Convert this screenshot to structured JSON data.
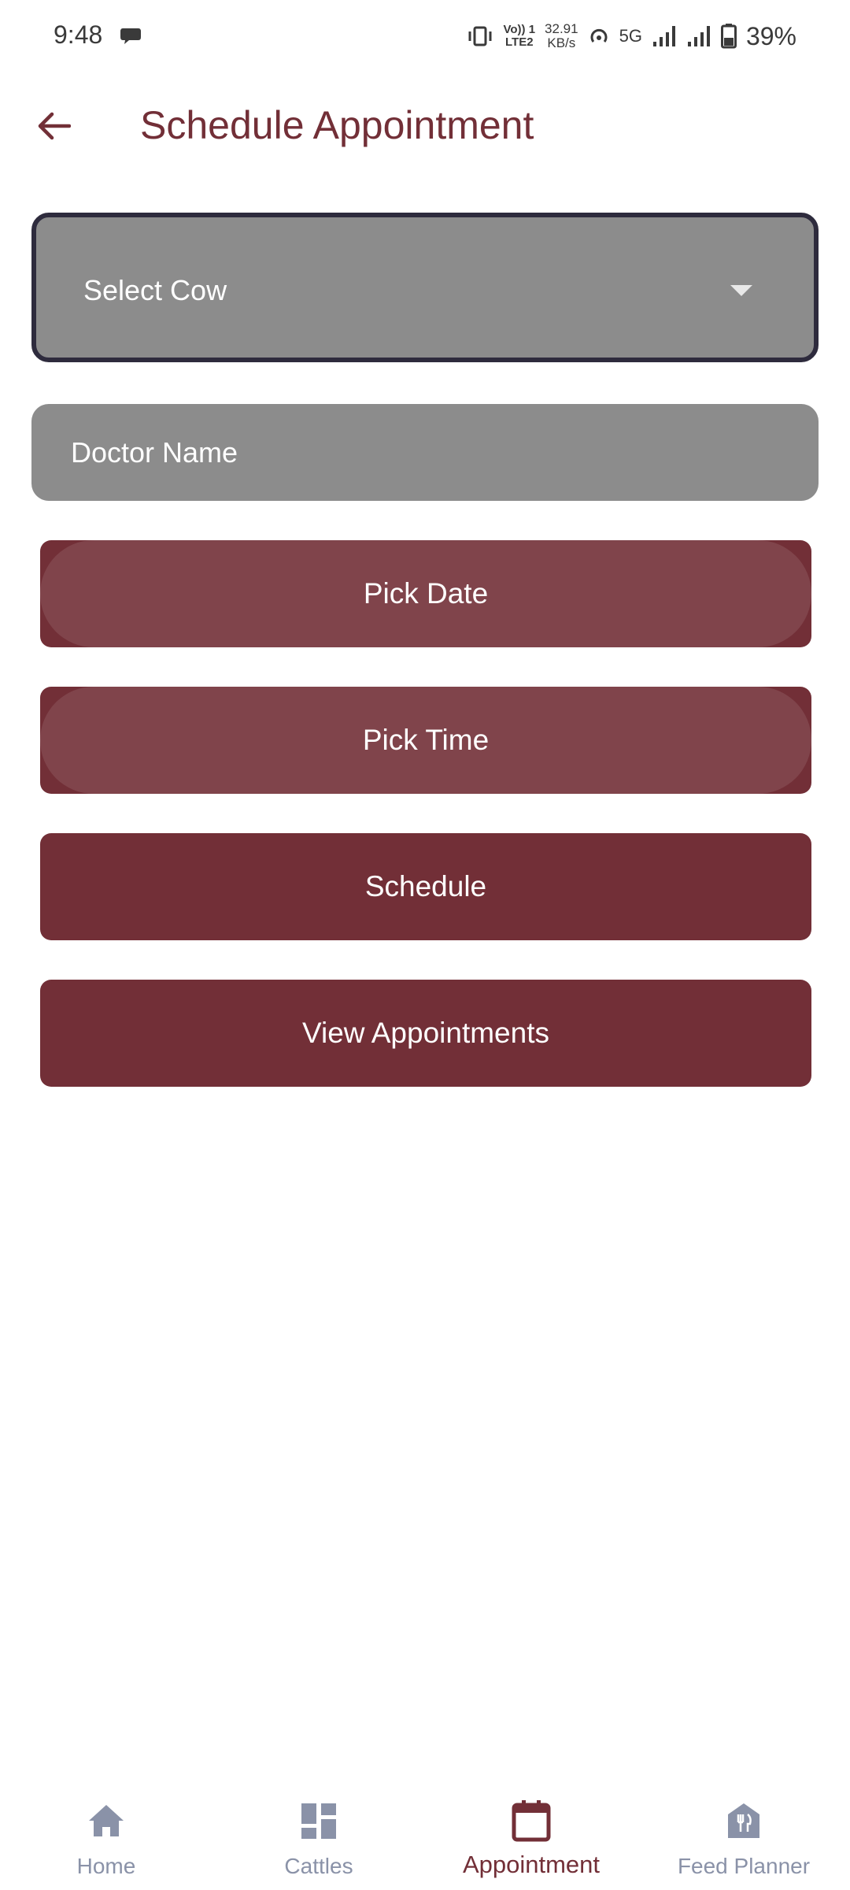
{
  "status_bar": {
    "time": "9:48",
    "net_line1": "Vo)) 1",
    "net_line2": "LTE2",
    "speed_line1": "32.91",
    "speed_line2": "KB/s",
    "network": "5G",
    "battery": "39%"
  },
  "app_bar": {
    "title": "Schedule Appointment",
    "back_icon": "arrow-back-icon"
  },
  "form": {
    "select_cow_label": "Select Cow",
    "doctor_name_placeholder": "Doctor Name",
    "pick_date_label": "Pick Date",
    "pick_time_label": "Pick Time",
    "schedule_label": "Schedule",
    "view_appointments_label": "View Appointments"
  },
  "bottom_nav": {
    "items": [
      {
        "label": "Home",
        "icon": "home-icon",
        "active": false
      },
      {
        "label": "Cattles",
        "icon": "dashboard-icon",
        "active": false
      },
      {
        "label": "Appointment",
        "icon": "calendar-icon",
        "active": true
      },
      {
        "label": "Feed Planner",
        "icon": "restaurant-icon",
        "active": false
      }
    ]
  },
  "colors": {
    "primary": "#722f37",
    "field_gray": "#8c8c8c",
    "nav_inactive": "#8a92a8",
    "focus_border": "#2e2b3d"
  }
}
